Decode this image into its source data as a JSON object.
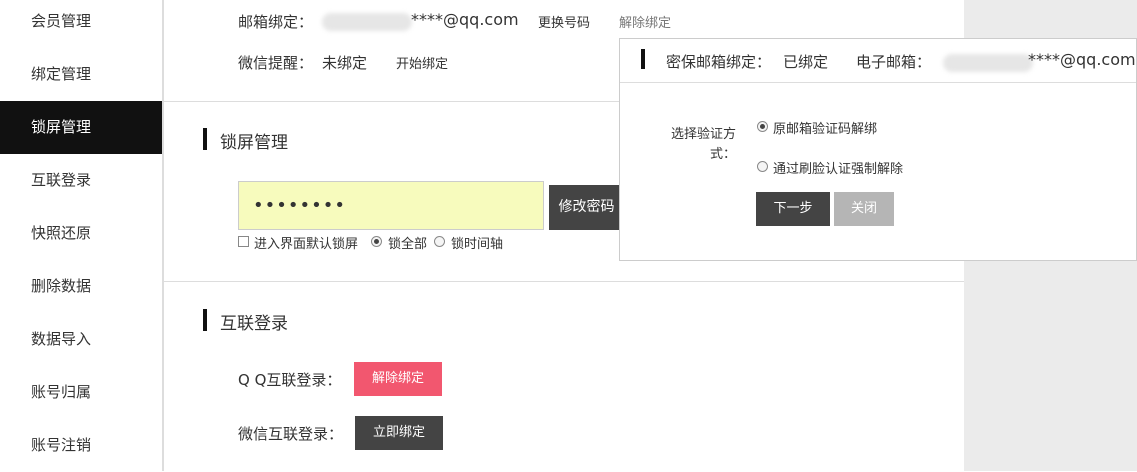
{
  "sidebar": {
    "items": [
      {
        "label": "会员管理",
        "active": false
      },
      {
        "label": "绑定管理",
        "active": false
      },
      {
        "label": "锁屏管理",
        "active": true
      },
      {
        "label": "互联登录",
        "active": false
      },
      {
        "label": "快照还原",
        "active": false
      },
      {
        "label": "删除数据",
        "active": false
      },
      {
        "label": "数据导入",
        "active": false
      },
      {
        "label": "账号归属",
        "active": false
      },
      {
        "label": "账号注销",
        "active": false
      }
    ]
  },
  "bind": {
    "email_label": "邮箱绑定：",
    "email_value": "****@qq.com",
    "change_link": "更换号码",
    "unbind_link": "解除绑定",
    "wechat_label": "微信提醒：",
    "wechat_value": "未绑定",
    "start_bind_link": "开始绑定"
  },
  "lock": {
    "title": "锁屏管理",
    "password": "••••••••",
    "modify_button": "修改密码",
    "default_lock_label": "进入界面默认锁屏",
    "lock_all_label": "锁全部",
    "lock_timeline_label": "锁时间轴"
  },
  "connect": {
    "title": "互联登录",
    "qq_label": "Q Q互联登录：",
    "qq_button": "解除绑定",
    "wechat_label": "微信互联登录：",
    "wechat_button": "立即绑定"
  },
  "popup": {
    "status_label": "密保邮箱绑定：",
    "status_value": "已绑定",
    "email_label": "电子邮箱：",
    "email_value": "****@qq.com",
    "method_label": "选择验证方式：",
    "option_email": "原邮箱验证码解绑",
    "option_face": "通过刷脸认证强制解除",
    "next_button": "下一步",
    "close_button": "关闭"
  },
  "colors": {
    "active_bg": "#111111",
    "pink_button": "#f2576f",
    "dark_button": "#444444",
    "disabled_button": "#b5b5b5",
    "input_bg": "#f7fbbd"
  }
}
